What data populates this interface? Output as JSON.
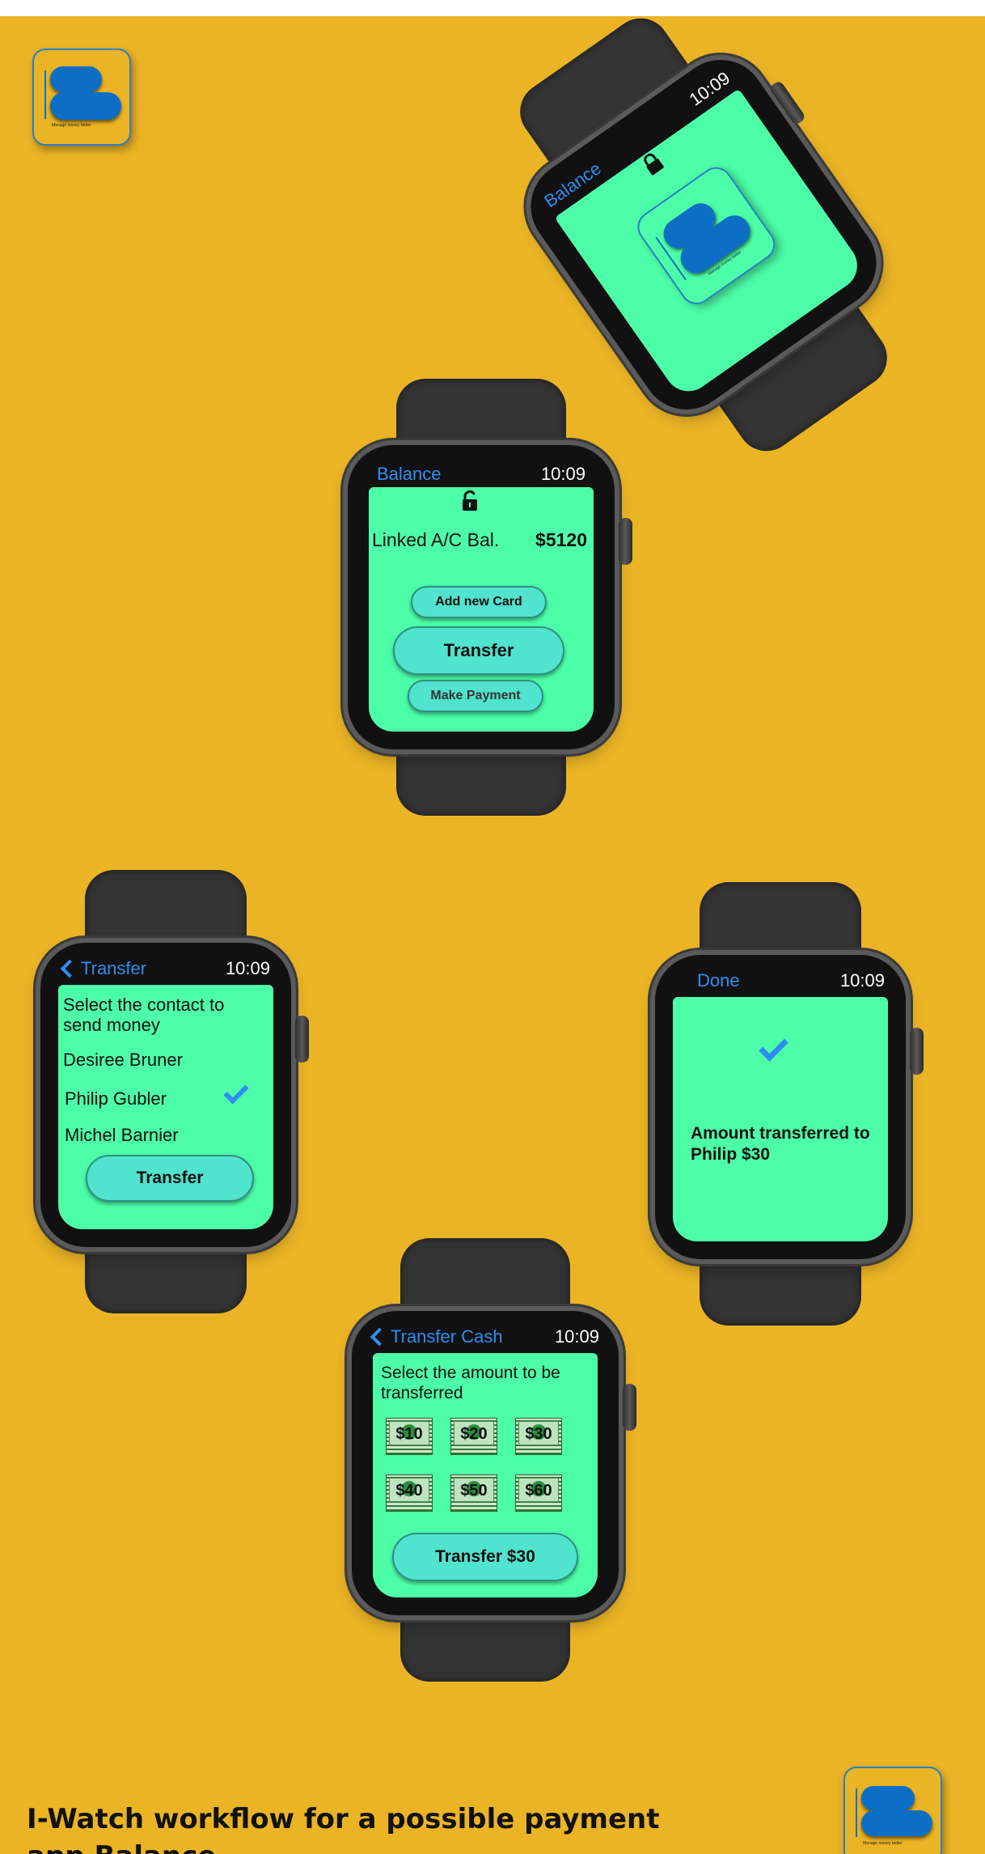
{
  "logo": {
    "text": "Manage money better",
    "accent": "#0c6fc5"
  },
  "colors": {
    "background": "#ebb425",
    "screen": "#4cfea8",
    "pill": "#50e3cd",
    "title": "#2d8ef0"
  },
  "watch_splash": {
    "title": "Balance",
    "time": "10:09",
    "icon": "lock-icon"
  },
  "watch_balance": {
    "title": "Balance",
    "time": "10:09",
    "icon": "lock-open-icon",
    "balance_label": "Linked A/C Bal.",
    "balance_value": "$5120",
    "add_card": "Add new Card",
    "transfer": "Transfer",
    "make_payment": "Make Payment"
  },
  "watch_contacts": {
    "title": "Transfer",
    "time": "10:09",
    "prompt": "Select the contact to send money",
    "contacts": [
      "Desiree Bruner",
      "Philip Gubler",
      "Michel Barnier"
    ],
    "selected": "Philip Gubler",
    "button": "Transfer"
  },
  "watch_done": {
    "title": "Done",
    "time": "10:09",
    "message": "Amount transferred to Philip $30"
  },
  "watch_amount": {
    "title": "Transfer Cash",
    "time": "10:09",
    "prompt": "Select the amount to be transferred",
    "amounts": [
      "$10",
      "$20",
      "$30",
      "$40",
      "$50",
      "$60"
    ],
    "button": "Transfer $30"
  },
  "footer": {
    "title": "I-Watch workflow for a possible payment app Balance"
  }
}
